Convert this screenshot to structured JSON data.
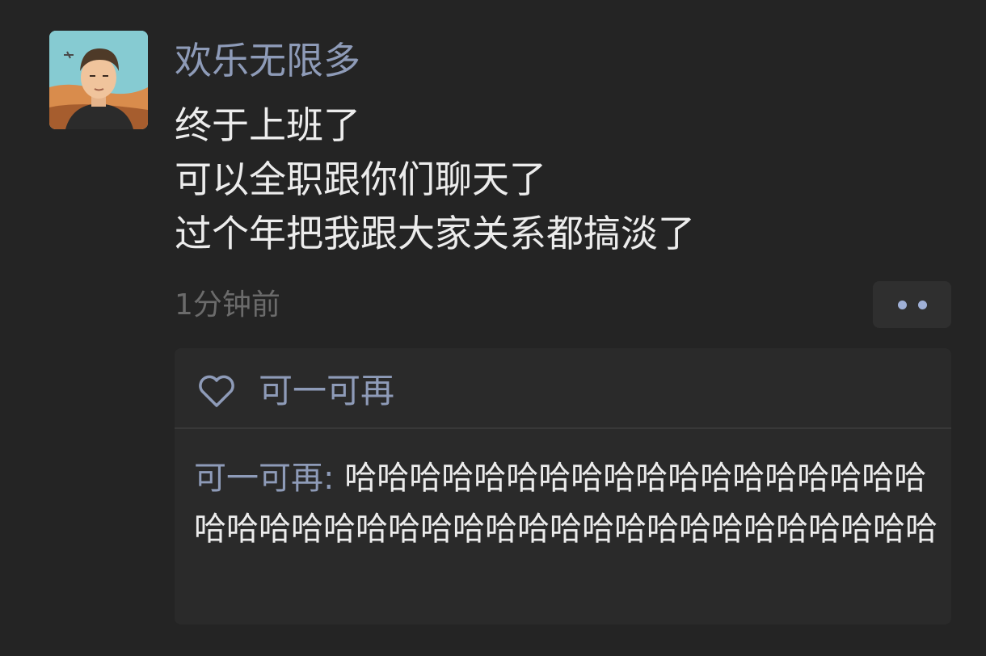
{
  "post": {
    "author": "欢乐无限多",
    "avatar_icon": "user-avatar-anime-character",
    "lines": [
      "终于上班了",
      "可以全职跟你们聊天了",
      "过个年把我跟大家关系都搞淡了"
    ],
    "timestamp": "1分钟前",
    "more_icon": "more-dots-icon"
  },
  "interactions": {
    "like_icon": "heart-outline-icon",
    "likers": "可一可再",
    "comments": [
      {
        "author": "可一可再",
        "separator": ": ",
        "text": "哈哈哈哈哈哈哈哈哈哈哈哈哈哈哈哈哈哈哈哈哈哈哈哈哈哈哈哈哈哈哈哈哈哈哈哈哈哈哈哈哈"
      }
    ]
  },
  "colors": {
    "background": "#242424",
    "name_link": "#8e9bb8",
    "text": "#ececec",
    "muted": "#6b6b6b",
    "panel": "#2a2a2a"
  }
}
